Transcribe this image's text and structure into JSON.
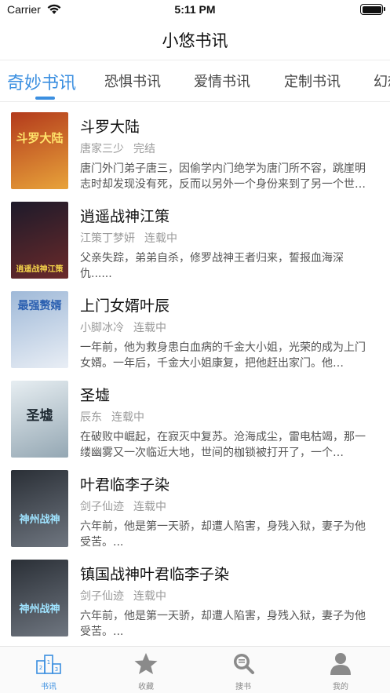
{
  "status_bar": {
    "carrier": "Carrier",
    "time": "5:11 PM",
    "battery_level": 1.0
  },
  "nav": {
    "title": "小悠书讯"
  },
  "tabs": [
    {
      "label": "奇妙书讯",
      "active": true
    },
    {
      "label": "恐惧书讯",
      "active": false
    },
    {
      "label": "爱情书讯",
      "active": false
    },
    {
      "label": "定制书讯",
      "active": false
    },
    {
      "label": "幻想",
      "active": false
    }
  ],
  "books": [
    {
      "title": "斗罗大陆",
      "author": "唐家三少",
      "status": "完结",
      "desc": "唐门外门弟子唐三，因偷学内门绝学为唐门所不容，跳崖明志时却发现没有死，反而以另外一个身份来到了另一个世界…",
      "cover_text": "斗罗大陆",
      "cover_colors": [
        "#b33a1c",
        "#e8a33a"
      ]
    },
    {
      "title": "逍遥战神江策",
      "author": "江策丁梦妍",
      "status": "连载中",
      "desc": "父亲失踪，弟弟自杀，修罗战神王者归来，誓报血海深仇......",
      "cover_text": "逍遥战神江策",
      "cover_colors": [
        "#1d1a2a",
        "#6b2a2a"
      ]
    },
    {
      "title": "上门女婿叶辰",
      "author": "小脚冰冷",
      "status": "连载中",
      "desc": "一年前，他为救身患白血病的千金大小姐，光荣的成为上门女婿。一年后，千金大小姐康复，把他赶出家门。他…",
      "cover_text": "最强赘婿",
      "cover_colors": [
        "#9fb9d8",
        "#e9eef5"
      ]
    },
    {
      "title": "圣墟",
      "author": "辰东",
      "status": "连载中",
      "desc": "在破败中崛起，在寂灭中复苏。沧海成尘，雷电枯竭，那一缕幽雾又一次临近大地，世间的枷锁被打开了，一个…",
      "cover_text": "圣墟",
      "cover_colors": [
        "#e7eef2",
        "#94a7b3"
      ]
    },
    {
      "title": "叶君临李子染",
      "author": "剑子仙迹",
      "status": "连载中",
      "desc": "六年前，他是第一天骄，却遭人陷害，身残入狱，妻子为他受苦。...",
      "cover_text": "神州战神",
      "cover_colors": [
        "#2a2f36",
        "#6f7680"
      ]
    },
    {
      "title": "镇国战神叶君临李子染",
      "author": "剑子仙迹",
      "status": "连载中",
      "desc": "六年前，他是第一天骄，却遭人陷害，身残入狱，妻子为他受苦。...",
      "cover_text": "神州战神",
      "cover_colors": [
        "#2a2f36",
        "#6f7680"
      ]
    }
  ],
  "tabbar": [
    {
      "label": "书讯",
      "icon": "podium-icon",
      "active": true
    },
    {
      "label": "收藏",
      "icon": "star-icon",
      "active": false
    },
    {
      "label": "搜书",
      "icon": "search-book-icon",
      "active": false
    },
    {
      "label": "我的",
      "icon": "person-icon",
      "active": false
    }
  ],
  "colors": {
    "accent": "#3b8fe0",
    "text": "#111111",
    "muted": "#9a9a9a"
  }
}
